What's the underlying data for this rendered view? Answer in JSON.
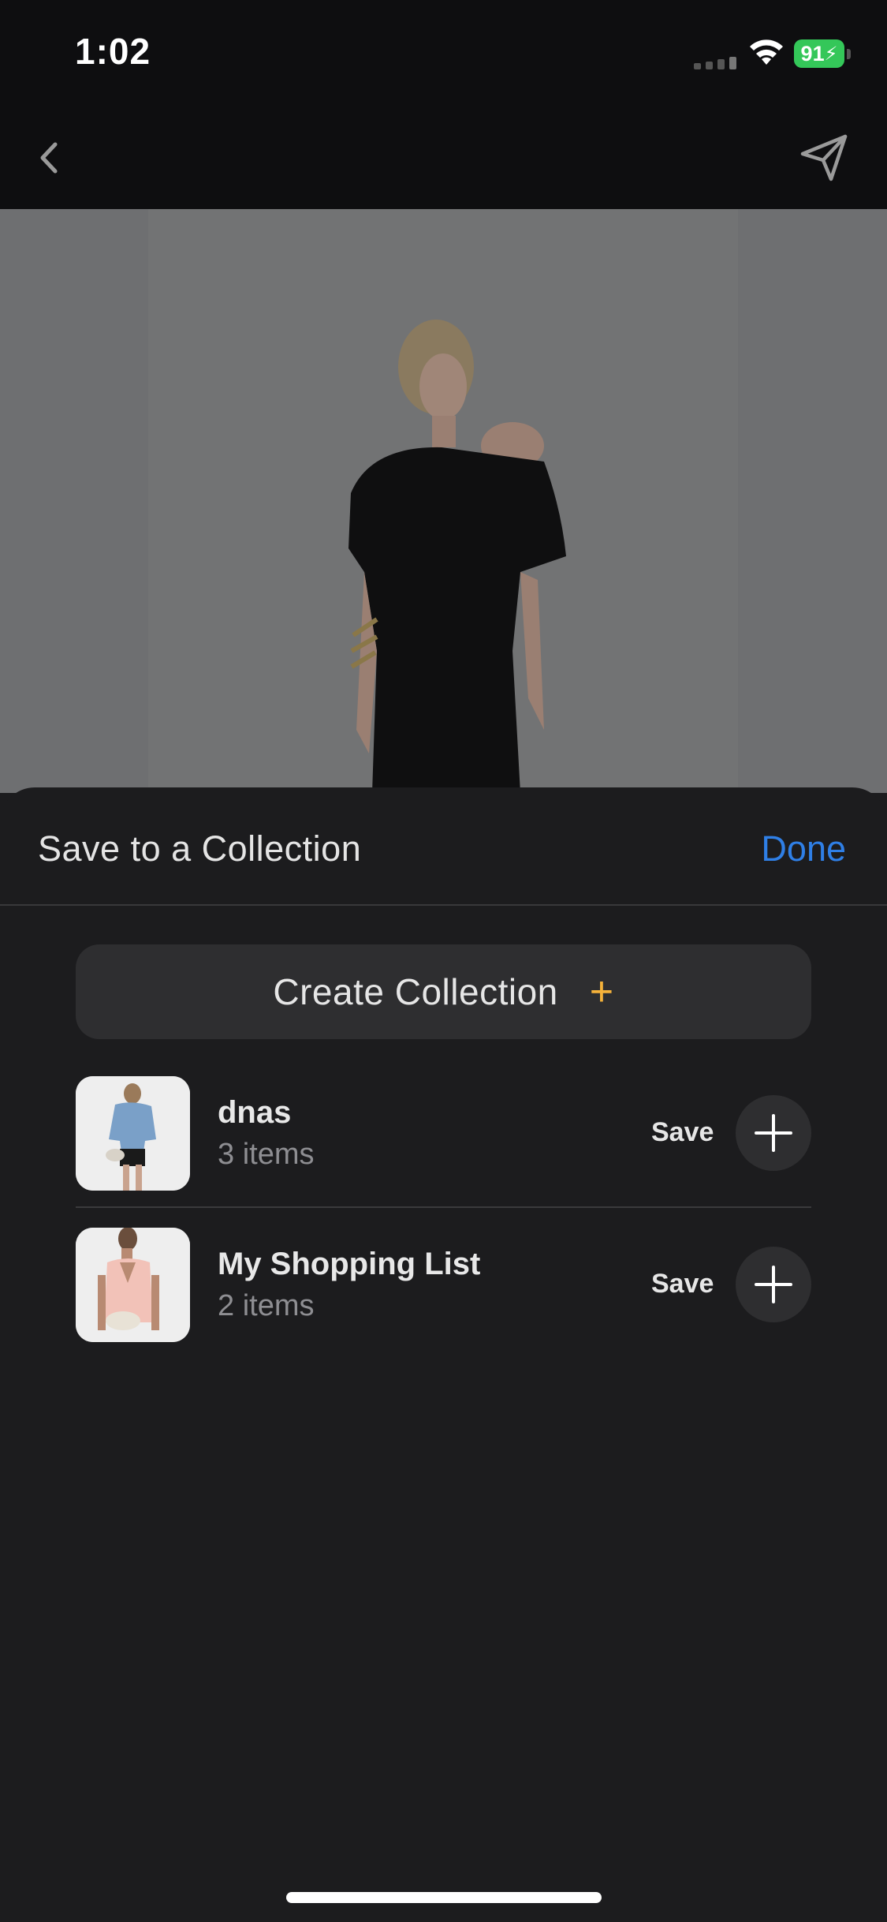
{
  "status_bar": {
    "time": "1:02",
    "battery_level": "91",
    "icons": [
      "signal-icon",
      "wifi-icon",
      "battery-charging-icon"
    ]
  },
  "nav": {
    "icons": [
      "back-chevron-icon",
      "send-icon"
    ]
  },
  "sheet": {
    "title": "Save to a Collection",
    "done_label": "Done",
    "create_label": "Create Collection",
    "create_plus": "+",
    "accent_color": "#2f7fe6",
    "plus_color": "#f5b23a"
  },
  "collections": [
    {
      "name": "dnas",
      "count": "3 items",
      "save_label": "Save"
    },
    {
      "name": "My Shopping List",
      "count": "2 items",
      "save_label": "Save"
    }
  ]
}
